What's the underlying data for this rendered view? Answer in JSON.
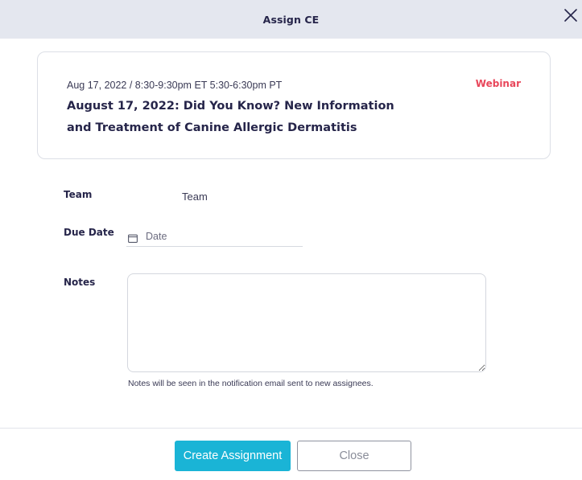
{
  "modal": {
    "title": "Assign CE",
    "close_icon": "close-icon"
  },
  "event": {
    "date_time": "Aug 17, 2022 / 8:30-9:30pm ET 5:30-6:30pm PT",
    "type": "Webinar",
    "title": "August 17, 2022: Did You Know? New Information and Treatment of Canine Allergic Dermatitis"
  },
  "form": {
    "team_label": "Team",
    "team_value": "Team",
    "due_date_label": "Due Date",
    "due_date_placeholder": "Date",
    "due_date_icon": "calendar-icon",
    "notes_label": "Notes",
    "notes_value": "",
    "notes_hint": "Notes will be seen in the notification email sent to new assignees."
  },
  "footer": {
    "create_label": "Create Assignment",
    "close_label": "Close"
  },
  "colors": {
    "header_bg": "#e4e7ef",
    "primary": "#1ab4d6",
    "webinar_accent": "#e8465a",
    "title_text": "#26254a"
  }
}
